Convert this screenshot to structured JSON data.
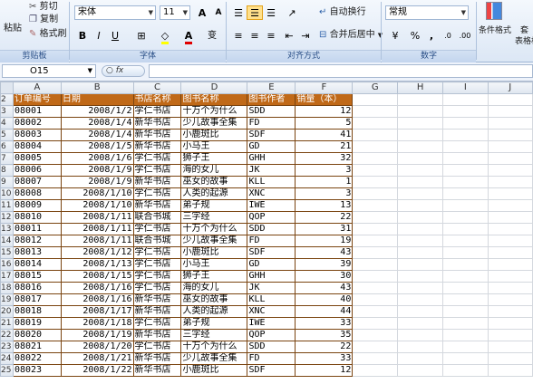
{
  "ribbon": {
    "clipboard": {
      "paste": "粘贴",
      "cut": "剪切",
      "copy": "复制",
      "format_painter": "格式刷",
      "group": "剪贴板"
    },
    "font": {
      "name": "宋体",
      "size": "11",
      "grow": "A",
      "shrink": "A",
      "bold": "B",
      "italic": "I",
      "underline": "U",
      "font_color": "A",
      "wen": "变",
      "group": "字体"
    },
    "alignment": {
      "wrap": "自动换行",
      "merge": "合并后居中",
      "group": "对齐方式"
    },
    "number": {
      "format": "常规",
      "percent": "%",
      "comma": ",",
      "inc": ".0",
      "dec": ".00",
      "group": "数字"
    },
    "styles": {
      "conditional": "条件格式",
      "table": "套",
      "table_format": "表格格"
    }
  },
  "formula": {
    "name_box": "O15",
    "fx": "fx",
    "value": ""
  },
  "columns": [
    "A",
    "B",
    "C",
    "D",
    "E",
    "F",
    "G",
    "H",
    "I",
    "J"
  ],
  "sheet": {
    "headers": [
      "订单编号",
      "日期",
      "书店名称",
      "图书名称",
      "图书作者",
      "销量（本）"
    ],
    "rows": [
      [
        "08001",
        "2008/1/2",
        "学仁书店",
        "十万个为什么",
        "SDD",
        "12"
      ],
      [
        "08002",
        "2008/1/4",
        "新华书店",
        "少儿故事全集",
        "FD",
        "5"
      ],
      [
        "08003",
        "2008/1/4",
        "新华书店",
        "小鹿斑比",
        "SDF",
        "41"
      ],
      [
        "08004",
        "2008/1/5",
        "新华书店",
        "小马王",
        "GD",
        "21"
      ],
      [
        "08005",
        "2008/1/6",
        "学仁书店",
        "狮子王",
        "GHH",
        "32"
      ],
      [
        "08006",
        "2008/1/9",
        "学仁书店",
        "海的女儿",
        "JK",
        "3"
      ],
      [
        "08007",
        "2008/1/9",
        "新华书店",
        "巫女的故事",
        "KLL",
        "1"
      ],
      [
        "08008",
        "2008/1/10",
        "学仁书店",
        "人类的起源",
        "XNC",
        "3"
      ],
      [
        "08009",
        "2008/1/10",
        "新华书店",
        "弟子规",
        "IWE",
        "13"
      ],
      [
        "08010",
        "2008/1/11",
        "联合书城",
        "三字经",
        "QOP",
        "22"
      ],
      [
        "08011",
        "2008/1/11",
        "学仁书店",
        "十万个为什么",
        "SDD",
        "31"
      ],
      [
        "08012",
        "2008/1/11",
        "联合书城",
        "少儿故事全集",
        "FD",
        "19"
      ],
      [
        "08013",
        "2008/1/12",
        "学仁书店",
        "小鹿斑比",
        "SDF",
        "43"
      ],
      [
        "08014",
        "2008/1/13",
        "学仁书店",
        "小马王",
        "GD",
        "39"
      ],
      [
        "08015",
        "2008/1/15",
        "学仁书店",
        "狮子王",
        "GHH",
        "30"
      ],
      [
        "08016",
        "2008/1/16",
        "学仁书店",
        "海的女儿",
        "JK",
        "43"
      ],
      [
        "08017",
        "2008/1/16",
        "新华书店",
        "巫女的故事",
        "KLL",
        "40"
      ],
      [
        "08018",
        "2008/1/17",
        "新华书店",
        "人类的起源",
        "XNC",
        "44"
      ],
      [
        "08019",
        "2008/1/18",
        "学仁书店",
        "弟子规",
        "IWE",
        "33"
      ],
      [
        "08020",
        "2008/1/19",
        "新华书店",
        "三字经",
        "QOP",
        "35"
      ],
      [
        "08021",
        "2008/1/20",
        "学仁书店",
        "十万个为什么",
        "SDD",
        "22"
      ],
      [
        "08022",
        "2008/1/21",
        "新华书店",
        "少儿故事全集",
        "FD",
        "33"
      ],
      [
        "08023",
        "2008/1/22",
        "新华书店",
        "小鹿斑比",
        "SDF",
        "12"
      ]
    ]
  }
}
